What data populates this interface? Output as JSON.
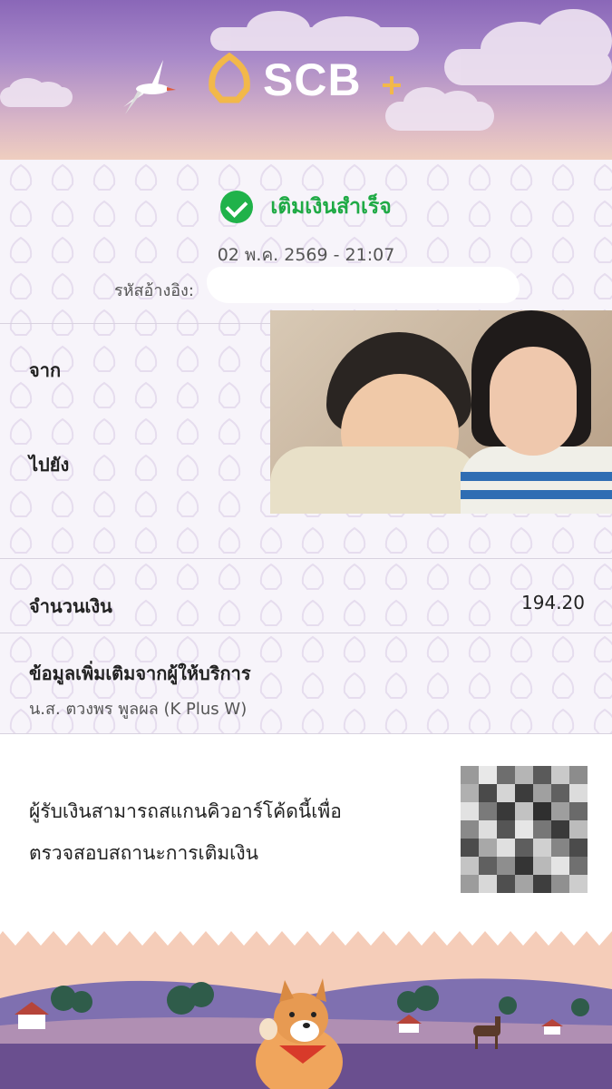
{
  "header": {
    "logo_text": "SCB",
    "icons": [
      "bird-icon",
      "scb-logo-icon",
      "plus-icon"
    ]
  },
  "status": {
    "label": "เติมเงินสำเร็จ",
    "datetime": "02 พ.ค. 2569 - 21:07",
    "ref_label": "รหัสอ้างอิง:"
  },
  "transfer": {
    "from_label": "จาก",
    "to_label": "ไปยัง"
  },
  "amount": {
    "label": "จำนวนเงิน",
    "value": "194.20"
  },
  "provider": {
    "label": "ข้อมูลเพิ่มเติมจากผู้ให้บริการ",
    "value": "น.ส. ตวงพร พูลผล (K Plus W)"
  },
  "qr_note": {
    "line1": "ผู้รับเงินสามารถสแกนคิวอาร์โค้ดนี้เพื่อ",
    "line2": "ตรวจสอบสถานะการเติมเงิน"
  },
  "colors": {
    "success": "#20b24a",
    "brand_purple": "#4e2a84",
    "brand_gold": "#f2b84a"
  }
}
